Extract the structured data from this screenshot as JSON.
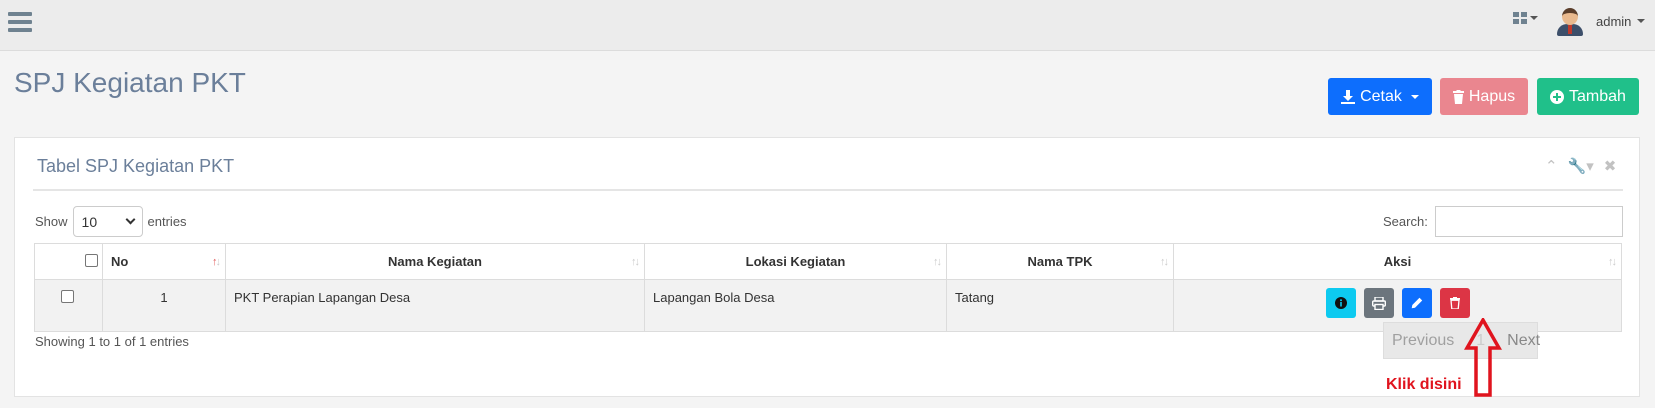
{
  "topbar": {
    "user": "admin",
    "icons": [
      "menu-icon",
      "grid-icon",
      "user-avatar"
    ]
  },
  "page": {
    "title": "SPJ Kegiatan PKT",
    "buttons": {
      "cetak": "Cetak",
      "hapus": "Hapus",
      "tambah": "Tambah"
    }
  },
  "panel": {
    "title": "Tabel SPJ Kegiatan PKT",
    "show_label": "Show",
    "entries_value": "10",
    "entries_label": "entries",
    "search_label": "Search:",
    "search_value": ""
  },
  "table": {
    "columns": [
      "No",
      "Nama Kegiatan",
      "Lokasi Kegiatan",
      "Nama TPK",
      "Aksi"
    ],
    "rows": [
      {
        "no": "1",
        "nama_kegiatan": "PKT Perapian Lapangan Desa",
        "lokasi": "Lapangan Bola Desa",
        "nama_tpk": "Tatang"
      }
    ],
    "action_icons": [
      "info-icon",
      "print-icon",
      "edit-icon",
      "trash-icon"
    ]
  },
  "footer": {
    "info": "Showing 1 to 1 of 1 entries",
    "previous": "Previous",
    "page": "1",
    "next": "Next"
  },
  "annotation": {
    "text": "Klik disini"
  },
  "colors": {
    "primary": "#0d6efd",
    "danger": "#dc3545",
    "danger_light": "#ea868f",
    "success": "#20c08a",
    "info": "#0dcaf0",
    "secondary": "#6c757d",
    "title": "#6b7f9a"
  }
}
